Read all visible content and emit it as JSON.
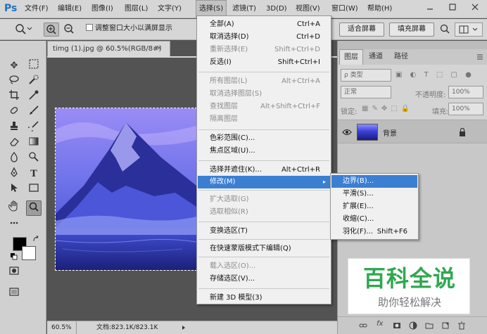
{
  "app": {
    "logo": "Ps"
  },
  "menubar": {
    "items": [
      "文件(F)",
      "编辑(E)",
      "图像(I)",
      "图层(L)",
      "文字(Y)",
      "选择(S)",
      "滤镜(T)",
      "3D(D)",
      "视图(V)",
      "窗口(W)",
      "帮助(H)"
    ],
    "active_index": 5
  },
  "options": {
    "zoom_in_icon": "zoom-in-icon",
    "zoom_out_icon": "zoom-out-icon",
    "resize_windows_label": "调整窗口大小以满屏显示",
    "fit_screen_label": "适合屏幕",
    "fill_screen_label": "填充屏幕"
  },
  "document": {
    "tab_title": "timg (1).jpg @ 60.5%(RGB/8#)",
    "close": "×",
    "zoom": "60.5%",
    "doc_info": "文档:823.1K/823.1K"
  },
  "select_menu": {
    "items": [
      {
        "label": "全部(A)",
        "shortcut": "Ctrl+A",
        "disabled": false
      },
      {
        "label": "取消选择(D)",
        "shortcut": "Ctrl+D",
        "disabled": false
      },
      {
        "label": "重新选择(E)",
        "shortcut": "Shift+Ctrl+D",
        "disabled": true
      },
      {
        "label": "反选(I)",
        "shortcut": "Shift+Ctrl+I",
        "disabled": false
      },
      {
        "label": "所有图层(L)",
        "shortcut": "Alt+Ctrl+A",
        "disabled": true
      },
      {
        "label": "取消选择图层(S)",
        "shortcut": "",
        "disabled": true
      },
      {
        "label": "查找图层",
        "shortcut": "Alt+Shift+Ctrl+F",
        "disabled": true
      },
      {
        "label": "隔离图层",
        "shortcut": "",
        "disabled": true
      },
      {
        "label": "色彩范围(C)...",
        "shortcut": "",
        "disabled": false
      },
      {
        "label": "焦点区域(U)...",
        "shortcut": "",
        "disabled": false
      },
      {
        "label": "选择并遮住(K)...",
        "shortcut": "Alt+Ctrl+R",
        "disabled": false
      },
      {
        "label": "修改(M)",
        "shortcut": "▸",
        "disabled": false
      },
      {
        "label": "扩大选取(G)",
        "shortcut": "",
        "disabled": true
      },
      {
        "label": "选取相似(R)",
        "shortcut": "",
        "disabled": true
      },
      {
        "label": "变换选区(T)",
        "shortcut": "",
        "disabled": false
      },
      {
        "label": "在快速蒙版模式下编辑(Q)",
        "shortcut": "",
        "disabled": false
      },
      {
        "label": "载入选区(O)...",
        "shortcut": "",
        "disabled": true
      },
      {
        "label": "存储选区(V)...",
        "shortcut": "",
        "disabled": false
      },
      {
        "label": "新建 3D 模型(3)",
        "shortcut": "",
        "disabled": false
      }
    ],
    "highlighted_index": 11
  },
  "modify_submenu": {
    "items": [
      {
        "label": "边界(B)...",
        "shortcut": ""
      },
      {
        "label": "平滑(S)...",
        "shortcut": ""
      },
      {
        "label": "扩展(E)...",
        "shortcut": ""
      },
      {
        "label": "收缩(C)...",
        "shortcut": ""
      },
      {
        "label": "羽化(F)...",
        "shortcut": "Shift+F6"
      }
    ],
    "highlighted_index": 0
  },
  "layers_panel": {
    "tabs": [
      "图层",
      "通道",
      "路径"
    ],
    "active_tab": 0,
    "kind_label": "ρ 类型",
    "blend_mode": "正常",
    "opacity_label": "不透明度:",
    "opacity_value": "100%",
    "lock_label": "锁定:",
    "fill_label": "填充:",
    "fill_value": "100%",
    "layer_name": "背景",
    "eye_icon": "eye-icon",
    "lock_icon": "lock-icon",
    "bottom_icons": [
      "link-icon",
      "fx-icon",
      "mask-icon",
      "adjustment-icon",
      "folder-icon",
      "new-layer-icon",
      "trash-icon"
    ]
  },
  "watermark": {
    "title": "百科全说",
    "subtitle": "助你轻松解决"
  },
  "colors": {
    "menu_highlight": "#3b7fd3",
    "watermark_green": "#2fa84f"
  }
}
